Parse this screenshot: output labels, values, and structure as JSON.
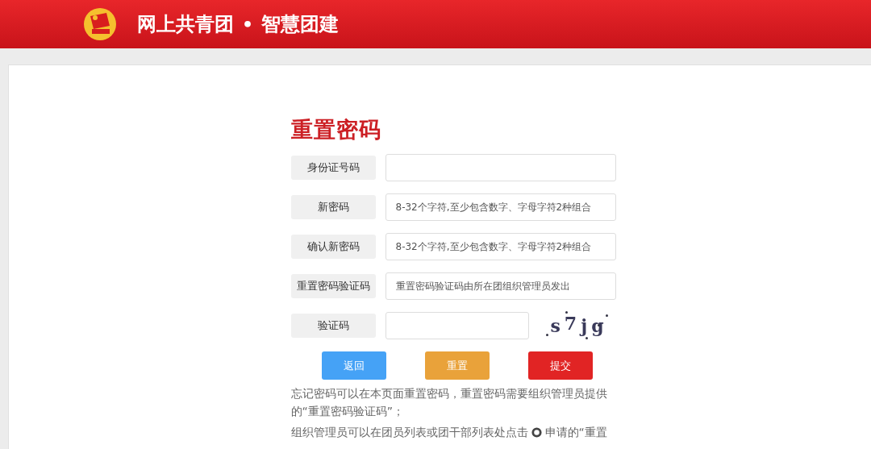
{
  "header": {
    "title": "网上共青团",
    "separator": "•",
    "subtitle": "智慧团建"
  },
  "form": {
    "title": "重置密码",
    "fields": [
      {
        "label": "身份证号码",
        "kind": "text"
      },
      {
        "label": "新密码",
        "placeholder": "8-32个字符,至少包含数字、字母字符2种组合",
        "kind": "text"
      },
      {
        "label": "确认新密码",
        "placeholder": "8-32个字符,至少包含数字、字母字符2种组合",
        "kind": "text"
      },
      {
        "label": "重置密码验证码",
        "placeholder": "重置密码验证码由所在团组织管理员发出",
        "kind": "text"
      },
      {
        "label": "验证码",
        "kind": "captcha",
        "captcha": "s7jg"
      }
    ],
    "buttons": [
      {
        "label": "返回",
        "color": "#45a2f6"
      },
      {
        "label": "重置",
        "color": "#e9a23a"
      },
      {
        "label": "提交",
        "color": "#e12424"
      }
    ]
  },
  "notes": [
    "忘记密码可以在本页面重置密码，重置密码需要组织管理员提供的“重置密码验证码”；"
  ],
  "cut_note": {
    "before": "组织管理员可以在团员列表或团干部列表处点击",
    "after": "申请的“重置"
  }
}
